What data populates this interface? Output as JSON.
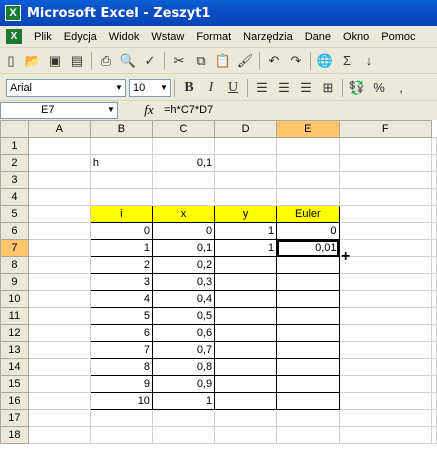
{
  "window": {
    "title": "Microsoft Excel - Zeszyt1"
  },
  "menu": [
    "Plik",
    "Edycja",
    "Widok",
    "Wstaw",
    "Format",
    "Narzędzia",
    "Dane",
    "Okno",
    "Pomoc"
  ],
  "toolbar": {
    "font_name": "Arial",
    "font_size": "10",
    "bold": "B",
    "italic": "I",
    "underline": "U",
    "sigma": "Σ",
    "percent": "%",
    "thousands": ","
  },
  "formula_bar": {
    "cell_ref": "E7",
    "fx": "fx",
    "formula": "=h*C7*D7"
  },
  "columns": [
    "A",
    "B",
    "C",
    "D",
    "E",
    "F"
  ],
  "rows": [
    "1",
    "2",
    "3",
    "4",
    "5",
    "6",
    "7",
    "8",
    "9",
    "10",
    "11",
    "12",
    "13",
    "14",
    "15",
    "16",
    "17",
    "18"
  ],
  "cells": {
    "B2": "h",
    "C2": "0,1",
    "B5": "i",
    "C5": "x",
    "D5": "y",
    "E5": "Euler",
    "B6": "0",
    "C6": "0",
    "D6": "1",
    "E6": "0",
    "B7": "1",
    "C7": "0,1",
    "D7": "1",
    "E7": "0,01",
    "B8": "2",
    "C8": "0,2",
    "B9": "3",
    "C9": "0,3",
    "B10": "4",
    "C10": "0,4",
    "B11": "5",
    "C11": "0,5",
    "B12": "6",
    "C12": "0,6",
    "B13": "7",
    "C13": "0,7",
    "B14": "8",
    "C14": "0,8",
    "B15": "9",
    "C15": "0,9",
    "B16": "10",
    "C16": "1"
  },
  "colors": {
    "header_fill": "#ffff00",
    "title_bar": "#0a5fd8",
    "selected_header": "#ffc66c"
  }
}
